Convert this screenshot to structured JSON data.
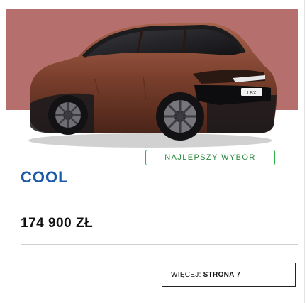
{
  "card": {
    "image": {
      "subject": "car-photo",
      "band_color": "#b5706d",
      "body_color": "#7a3f2c",
      "plate_text": "LBX"
    },
    "badge": {
      "label": "NAJLEPSZY WYBÓR",
      "color": "#2db34a"
    },
    "trim": {
      "name": "COOL",
      "color": "#1a5aa8"
    },
    "price": {
      "text": "174 900 ZŁ"
    },
    "more": {
      "prefix": "WIĘCEJ:",
      "label": "STRONA 7",
      "icon": "arrow-line-icon"
    }
  }
}
